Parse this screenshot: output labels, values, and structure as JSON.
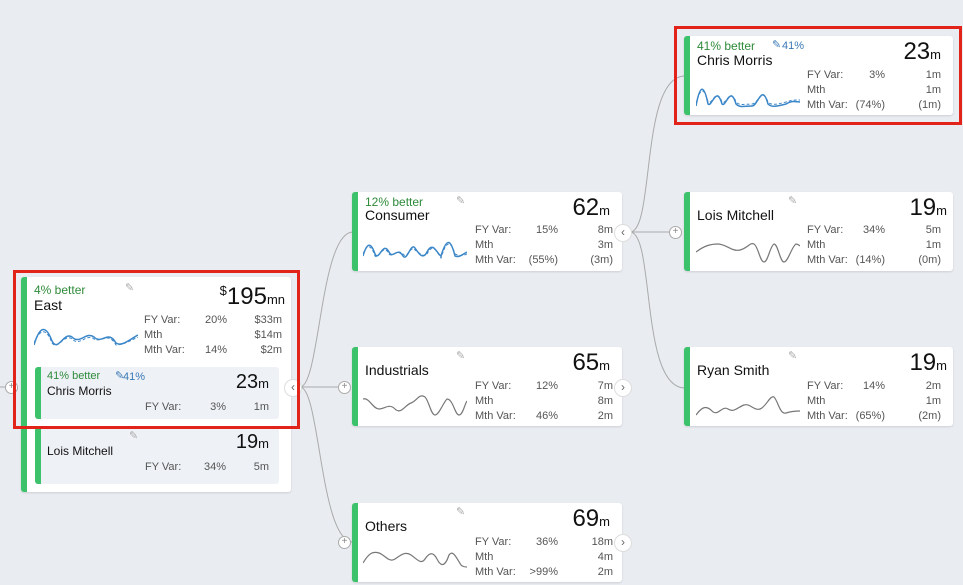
{
  "colors": {
    "accent_green": "#3cc26b",
    "better_green": "#2e8b3a",
    "link_blue": "#3a79b6",
    "highlight_red": "#e2231a",
    "background": "#e9ecf1"
  },
  "icons": {
    "edit": "pencil-icon",
    "expand": "chevron-right-icon",
    "collapse": "chevron-left-icon",
    "add": "plus-circle-icon"
  },
  "labels": {
    "fy_var": "FY Var:",
    "mth": "Mth",
    "mth_var": "Mth Var:"
  },
  "east": {
    "better": "4% better",
    "name": "East",
    "currency": "$",
    "value": "195",
    "unit": "mn",
    "fy_var_pct": "20%",
    "fy_var_amt": "$33m",
    "mth_amt": "$14m",
    "mth_var_pct": "14%",
    "mth_var_amt": "$2m",
    "children": [
      {
        "better": "41% better",
        "pct": "41%",
        "name": "Chris Morris",
        "value": "23",
        "unit": "m",
        "fy_var_pct": "3%",
        "fy_var_amt": "1m"
      },
      {
        "name": "Lois Mitchell",
        "value": "19",
        "unit": "m",
        "fy_var_pct": "34%",
        "fy_var_amt": "5m"
      }
    ]
  },
  "segments": [
    {
      "better": "12% better",
      "name": "Consumer",
      "value": "62",
      "unit": "m",
      "fy_var_pct": "15%",
      "fy_var_amt": "8m",
      "mth_amt": "3m",
      "mth_var_pct": "(55%)",
      "mth_var_amt": "(3m)"
    },
    {
      "name": "Industrials",
      "value": "65",
      "unit": "m",
      "fy_var_pct": "12%",
      "fy_var_amt": "7m",
      "mth_amt": "8m",
      "mth_var_pct": "46%",
      "mth_var_amt": "2m"
    },
    {
      "name": "Others",
      "value": "69",
      "unit": "m",
      "fy_var_pct": "36%",
      "fy_var_amt": "18m",
      "mth_amt": "4m",
      "mth_var_pct": ">99%",
      "mth_var_amt": "2m"
    }
  ],
  "people": [
    {
      "better": "41% better",
      "pct": "41%",
      "name": "Chris Morris",
      "value": "23",
      "unit": "m",
      "fy_var_pct": "3%",
      "fy_var_amt": "1m",
      "mth_amt": "1m",
      "mth_var_pct": "(74%)",
      "mth_var_amt": "(1m)"
    },
    {
      "name": "Lois Mitchell",
      "value": "19",
      "unit": "m",
      "fy_var_pct": "34%",
      "fy_var_amt": "5m",
      "mth_amt": "1m",
      "mth_var_pct": "(14%)",
      "mth_var_amt": "(0m)"
    },
    {
      "name": "Ryan Smith",
      "value": "19",
      "unit": "m",
      "fy_var_pct": "14%",
      "fy_var_amt": "2m",
      "mth_amt": "1m",
      "mth_var_pct": "(65%)",
      "mth_var_amt": "(2m)"
    }
  ]
}
